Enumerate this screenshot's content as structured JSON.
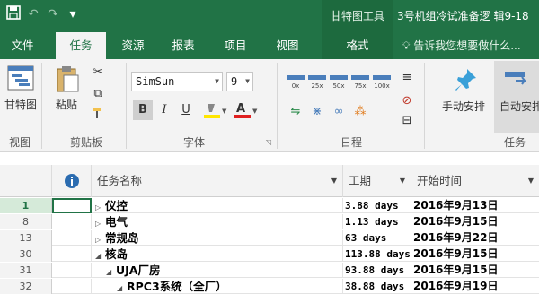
{
  "qat": {
    "save_icon": "save-icon",
    "undo_glyph": "↶",
    "redo_glyph": "↷",
    "customize_glyph": "▾"
  },
  "title": {
    "context_tool": "甘特图工具",
    "document": "3号机组冷试准备逻 辑9-18"
  },
  "tabs": [
    {
      "label": "文件"
    },
    {
      "label": "任务",
      "active": true
    },
    {
      "label": "资源"
    },
    {
      "label": "报表"
    },
    {
      "label": "项目"
    },
    {
      "label": "视图"
    },
    {
      "label": "格式",
      "contextual": true
    }
  ],
  "tell_me": "告诉我您想要做什么...",
  "ribbon": {
    "view_group": {
      "button": "甘特图",
      "label": "视图"
    },
    "clipboard_group": {
      "paste": "粘贴",
      "label": "剪贴板"
    },
    "font_group": {
      "font_name": "SimSun",
      "font_size": "9",
      "bold": "B",
      "italic": "I",
      "underline": "U",
      "label": "字体"
    },
    "schedule_group": {
      "label": "日程",
      "percents": [
        "0x",
        "25x",
        "50x",
        "75x",
        "100x"
      ]
    },
    "tasks_group": {
      "manual": "手动安排",
      "auto": "自动安排",
      "label": "任务"
    }
  },
  "colors": {
    "accent": "#217346",
    "ribbon_bg": "#f3f3f3",
    "header_bg": "#f3f3f3"
  },
  "table": {
    "columns": {
      "info_icon": "info-icon",
      "name": "任务名称",
      "duration": "工期",
      "start": "开始时间"
    },
    "rows": [
      {
        "id": "1",
        "name": "仪控",
        "expander": "▷",
        "indent": 0,
        "duration": "3.88 days",
        "start": "2016年9月13日",
        "selected": true
      },
      {
        "id": "8",
        "name": "电气",
        "expander": "▷",
        "indent": 0,
        "duration": "1.13 days",
        "start": "2016年9月15日"
      },
      {
        "id": "13",
        "name": "常规岛",
        "expander": "▷",
        "indent": 0,
        "duration": "63 days",
        "start": "2016年9月22日"
      },
      {
        "id": "30",
        "name": "核岛",
        "expander": "◢",
        "indent": 0,
        "duration": "113.88 days",
        "start": "2016年9月15日"
      },
      {
        "id": "31",
        "name": "UJA厂房",
        "expander": "◢",
        "indent": 1,
        "duration": "93.88 days",
        "start": "2016年9月15日"
      },
      {
        "id": "32",
        "name": "RPC3系统（全厂）",
        "expander": "◢",
        "indent": 2,
        "duration": "38.88 days",
        "start": "2016年9月19日"
      }
    ]
  }
}
